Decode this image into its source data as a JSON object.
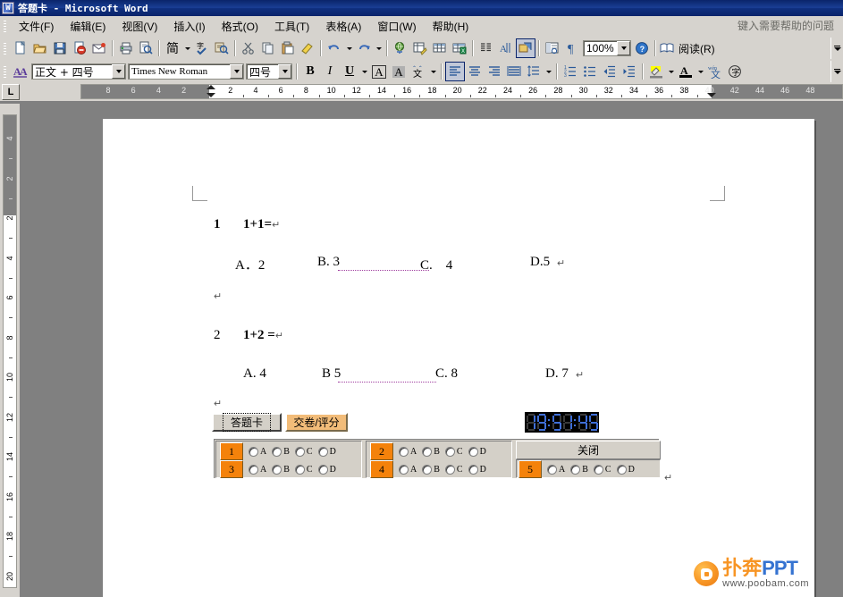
{
  "window": {
    "title": "答题卡 - Microsoft Word",
    "icon": "word-document-icon"
  },
  "menubar": {
    "items": [
      {
        "label": "文件(F)"
      },
      {
        "label": "编辑(E)"
      },
      {
        "label": "视图(V)"
      },
      {
        "label": "插入(I)"
      },
      {
        "label": "格式(O)"
      },
      {
        "label": "工具(T)"
      },
      {
        "label": "表格(A)"
      },
      {
        "label": "窗口(W)"
      },
      {
        "label": "帮助(H)"
      }
    ],
    "help_box_placeholder": "键入需要帮助的问题"
  },
  "standard_toolbar": {
    "buttons": [
      {
        "name": "new-document-icon",
        "tip": "新建空白文档"
      },
      {
        "name": "open-folder-icon",
        "tip": "打开"
      },
      {
        "name": "save-icon",
        "tip": "保存"
      },
      {
        "name": "permission-icon",
        "tip": "权限"
      },
      {
        "name": "email-icon",
        "tip": "电子邮件"
      },
      {
        "name": "print-icon",
        "tip": "打印"
      },
      {
        "name": "print-preview-icon",
        "tip": "打印预览"
      },
      {
        "name": "simplified-traditional-icon",
        "label": "简"
      },
      {
        "name": "spelling-check-icon",
        "tip": "拼写和语法"
      },
      {
        "name": "research-icon",
        "tip": "信息检索"
      },
      {
        "name": "cut-icon",
        "tip": "剪切"
      },
      {
        "name": "copy-icon",
        "tip": "复制"
      },
      {
        "name": "paste-icon",
        "tip": "粘贴"
      },
      {
        "name": "format-painter-icon",
        "tip": "格式刷"
      },
      {
        "name": "undo-icon",
        "tip": "撤消"
      },
      {
        "name": "redo-icon",
        "tip": "恢复"
      },
      {
        "name": "hyperlink-icon",
        "tip": "插入超链接"
      },
      {
        "name": "insert-table-excel-icon",
        "tip": "表格和边框"
      },
      {
        "name": "insert-table-icon",
        "tip": "插入表格"
      },
      {
        "name": "insert-excel-sheet-icon",
        "tip": "插入 Excel 表格"
      },
      {
        "name": "columns-icon",
        "tip": "分栏"
      },
      {
        "name": "drawing-icon",
        "tip": "绘图"
      },
      {
        "name": "document-map-icon",
        "tip": "文档结构图"
      },
      {
        "name": "show-formatting-icon",
        "tip": "显示/隐藏编辑标记"
      },
      {
        "name": "help-icon",
        "tip": "Microsoft Office Word 帮助"
      }
    ],
    "zoom_value": "100%",
    "read_label": "阅读(R)"
  },
  "formatting_toolbar": {
    "styles_icon": "styles-and-formatting-icon",
    "style_value": "正文 + 四号",
    "font_value": "Times New Roman",
    "size_value": "四号",
    "bold_label": "B",
    "italic_label": "I",
    "underline_label": "U",
    "char_border_label": "A",
    "char_shading_label": "A",
    "buttons": [
      {
        "name": "highlight-pinyin-icon"
      },
      {
        "name": "align-left-icon"
      },
      {
        "name": "align-center-icon"
      },
      {
        "name": "align-right-icon"
      },
      {
        "name": "justify-icon"
      },
      {
        "name": "line-spacing-icon"
      },
      {
        "name": "numbered-list-icon"
      },
      {
        "name": "bulleted-list-icon"
      },
      {
        "name": "decrease-indent-icon"
      },
      {
        "name": "increase-indent-icon"
      },
      {
        "name": "highlight-color-icon"
      },
      {
        "name": "font-color-icon"
      },
      {
        "name": "phonetic-guide-icon"
      },
      {
        "name": "character-border-icon"
      }
    ]
  },
  "ruler": {
    "tab_selector_glyph": "L",
    "horizontal_labels": [
      "8",
      "6",
      "4",
      "2",
      "2",
      "4",
      "6",
      "8",
      "10",
      "12",
      "14",
      "16",
      "18",
      "20",
      "22",
      "24",
      "26",
      "28",
      "30",
      "32",
      "34",
      "36",
      "38",
      "40",
      "42",
      "44",
      "46",
      "48"
    ],
    "vertical_labels": [
      "4",
      "2",
      "2",
      "4",
      "6",
      "8",
      "10",
      "12",
      "14",
      "16",
      "18",
      "20"
    ]
  },
  "document": {
    "questions": [
      {
        "number": "1",
        "stem": "1+1=",
        "pilcrow": "↵",
        "options": [
          {
            "label": "A．2"
          },
          {
            "label": "B. 3"
          },
          {
            "label": "C.　4"
          },
          {
            "label": "D.5"
          }
        ],
        "option_pilcrow": "↵"
      },
      {
        "number": "2",
        "stem": "1+2 =",
        "pilcrow": "↵",
        "options": [
          {
            "label": "A. 4"
          },
          {
            "label": "B 5"
          },
          {
            "label": "C. 8"
          },
          {
            "label": "D. 7"
          }
        ],
        "option_pilcrow": "↵"
      }
    ],
    "empty_paragraph_marks": [
      "↵",
      "↵"
    ],
    "trailing_mark": "↵"
  },
  "answer_card": {
    "card_button_label": "答题卡",
    "submit_button_label": "交卷/评分",
    "close_button_label": "关闭",
    "clock": {
      "time": "19:51:45",
      "lit_color": "#3f6fd8",
      "unlit_color": "#3a3a3a",
      "background": "#000000"
    },
    "number_cell_color": "#f4820b",
    "panel_background": "#d4d0c8",
    "rows": [
      {
        "number": "1",
        "options": [
          "A",
          "B",
          "C",
          "D"
        ]
      },
      {
        "number": "2",
        "options": [
          "A",
          "B",
          "C",
          "D"
        ]
      },
      {
        "number": "3",
        "options": [
          "A",
          "B",
          "C",
          "D"
        ]
      },
      {
        "number": "4",
        "options": [
          "A",
          "B",
          "C",
          "D"
        ]
      },
      {
        "number": "5",
        "options": [
          "A",
          "B",
          "C",
          "D"
        ]
      }
    ]
  },
  "watermark": {
    "brand_cn": "扑奔",
    "brand_ppt": "PPT",
    "url": "www.poobam.com",
    "logo": "poobam-logo-icon"
  }
}
